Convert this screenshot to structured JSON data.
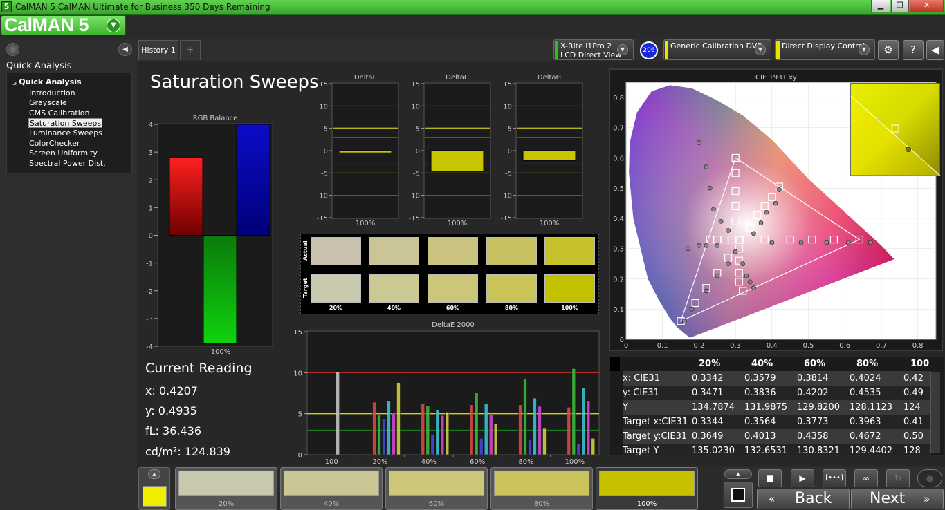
{
  "window": {
    "title": "CalMAN 5 CalMAN Ultimate for Business 350 Days Remaining",
    "app_icon": "5",
    "minimize": "▁",
    "maximize": "❐",
    "close": "✕"
  },
  "logo": {
    "text": "CalMAN 5",
    "drop_icon": "chevron-down-icon"
  },
  "sidebar": {
    "heading": "Quick Analysis",
    "root": "Quick Analysis",
    "items": [
      {
        "label": "Introduction"
      },
      {
        "label": "Grayscale"
      },
      {
        "label": "CMS Calibration"
      },
      {
        "label": "Saturation Sweeps",
        "selected": true
      },
      {
        "label": "Luminance Sweeps"
      },
      {
        "label": "ColorChecker"
      },
      {
        "label": "Screen Uniformity"
      },
      {
        "label": "Spectral Power Dist."
      }
    ]
  },
  "tabs": {
    "history": "History 1",
    "add": "+"
  },
  "devices": {
    "meter_line1": "X-Rite i1Pro 2",
    "meter_line2": "LCD Direct View",
    "meter_color": "#27c21a",
    "source": "Generic Calibration DVD",
    "source_color": "#e9e400",
    "display": "Direct Display Control",
    "display_color": "#e9e400",
    "badge": "206"
  },
  "page": {
    "title": "Saturation Sweeps"
  },
  "rgb_balance": {
    "title": "RGB Balance",
    "xlabel": "100%",
    "ticks": [
      "4",
      "3",
      "2",
      "1",
      "0",
      "-1",
      "-2",
      "-3",
      "-4"
    ],
    "values": {
      "red": 2.8,
      "green": -3.9,
      "blue": 4.0
    }
  },
  "delta_charts": [
    {
      "title": "DeltaL",
      "xlabel": "100%",
      "value": -0.5
    },
    {
      "title": "DeltaC",
      "xlabel": "100%",
      "value": -4.6
    },
    {
      "title": "DeltaH",
      "xlabel": "100%",
      "value": -2.2
    }
  ],
  "delta_ticks": [
    "15",
    "10",
    "5",
    "0",
    "-5",
    "-10",
    "-15"
  ],
  "swatches": {
    "actual_label": "Actual",
    "target_label": "Target",
    "levels": [
      "20%",
      "40%",
      "60%",
      "80%",
      "100%"
    ],
    "actual_colors": [
      "#c9c1ad",
      "#cbc496",
      "#cbc380",
      "#c8c162",
      "#c6c02b"
    ],
    "target_colors": [
      "#c9c9ad",
      "#cbc894",
      "#cbc67a",
      "#c9c358",
      "#c3c000"
    ]
  },
  "deltae_chart": {
    "title": "DeltaE 2000",
    "ticks": [
      "15",
      "10",
      "5",
      "0"
    ],
    "categories": [
      "100",
      "20%",
      "40%",
      "60%",
      "80%",
      "100%"
    ],
    "series_colors": [
      "#e24a4a",
      "#3fbf3f",
      "#4a4ae2",
      "#3fc9d9",
      "#d94ad9",
      "#d9d94a",
      "#cccccc"
    ],
    "groups": [
      [
        10.1
      ],
      [
        6.4,
        4.9,
        4.4,
        6.6,
        5.0,
        8.8
      ],
      [
        6.2,
        6.0,
        2.5,
        5.5,
        4.8,
        5.2
      ],
      [
        6.1,
        7.6,
        2.0,
        6.2,
        4.9,
        3.8
      ],
      [
        6.1,
        9.2,
        1.8,
        6.9,
        5.9,
        3.2
      ],
      [
        5.8,
        10.5,
        1.4,
        8.2,
        6.6,
        2.0
      ]
    ]
  },
  "current_reading": {
    "heading": "Current Reading",
    "x": "x: 0.4207",
    "y": "y: 0.4935",
    "fl": "fL: 36.436",
    "cdm": "cd/m²: 124.839"
  },
  "cie": {
    "title": "CIE 1931 xy",
    "xticks": [
      "0",
      "0.1",
      "0.2",
      "0.3",
      "0.4",
      "0.5",
      "0.6",
      "0.7",
      "0.8"
    ],
    "yticks": [
      "0.8",
      "0.7",
      "0.6",
      "0.5",
      "0.4",
      "0.3",
      "0.2",
      "0.1",
      "0"
    ]
  },
  "table": {
    "headers": [
      "20%",
      "40%",
      "60%",
      "80%",
      "100"
    ],
    "rows": [
      {
        "label": "x: CIE31",
        "values": [
          "0.3342",
          "0.3579",
          "0.3814",
          "0.4024",
          "0.42"
        ]
      },
      {
        "label": "y: CIE31",
        "values": [
          "0.3471",
          "0.3836",
          "0.4202",
          "0.4535",
          "0.49"
        ]
      },
      {
        "label": "Y",
        "values": [
          "134.7874",
          "131.9875",
          "129.8200",
          "128.1123",
          "124"
        ]
      },
      {
        "label": "Target x:CIE31",
        "values": [
          "0.3344",
          "0.3564",
          "0.3773",
          "0.3963",
          "0.41"
        ]
      },
      {
        "label": "Target y:CIE31",
        "values": [
          "0.3649",
          "0.4013",
          "0.4358",
          "0.4672",
          "0.50"
        ]
      },
      {
        "label": "Target Y",
        "values": [
          "135.0230",
          "132.6531",
          "130.8321",
          "129.4402",
          "128"
        ]
      }
    ]
  },
  "bottom": {
    "current_color": "#f0ee00",
    "patches": [
      {
        "label": "20%",
        "color": "#c8c8ae"
      },
      {
        "label": "40%",
        "color": "#cbc794"
      },
      {
        "label": "60%",
        "color": "#cdc77a"
      },
      {
        "label": "80%",
        "color": "#cac35b"
      },
      {
        "label": "100%",
        "color": "#c6c000"
      }
    ],
    "back": "Back",
    "next": "Next"
  }
}
